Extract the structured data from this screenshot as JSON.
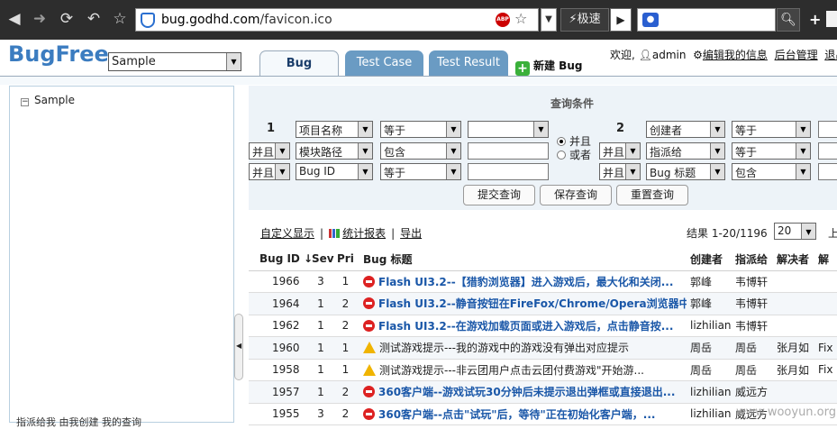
{
  "browser": {
    "url_domain": "bug.godhd.com",
    "url_path": "/favicon.ico",
    "speed_label": "极速",
    "abp_label": "ABP"
  },
  "app": {
    "logo": "BugFree",
    "project": "Sample",
    "tabs": [
      "Bug",
      "Test Case",
      "Test Result"
    ],
    "new_bug": "新建 Bug",
    "user": {
      "greeting": "欢迎,",
      "name": "admin",
      "edit_info": "编辑我的信息",
      "admin": "后台管理",
      "logout": "退出"
    }
  },
  "sidebar": {
    "root": "Sample",
    "bottom_tabs": "指派给我    由我创建    我的查询"
  },
  "query": {
    "title": "查询条件",
    "group1": "1",
    "group2": "2",
    "rows_left": [
      {
        "logic": "",
        "field": "项目名称",
        "op": "等于",
        "value": ""
      },
      {
        "logic": "并且",
        "field": "模块路径",
        "op": "包含",
        "value": ""
      },
      {
        "logic": "并且",
        "field": "Bug ID",
        "op": "等于",
        "value": ""
      }
    ],
    "rows_right": [
      {
        "logic": "",
        "field": "创建者",
        "op": "等于"
      },
      {
        "logic": "并且",
        "field": "指派给",
        "op": "等于"
      },
      {
        "logic": "并且",
        "field": "Bug 标题",
        "op": "包含"
      }
    ],
    "and_label": "并且",
    "or_label": "或者",
    "buttons": {
      "submit": "提交查询",
      "save": "保存查询",
      "reset": "重置查询"
    }
  },
  "toolbar": {
    "custom_display": "自定义显示",
    "stats": "统计报表",
    "export": "导出",
    "results": "结果 1-20/1196",
    "page_size": "20",
    "prev": "上"
  },
  "table": {
    "headers": [
      "Bug ID ↓",
      "Sev",
      "Pri",
      "Bug 标题",
      "创建者",
      "指派给",
      "解决者",
      "解"
    ],
    "rows": [
      {
        "id": "1966",
        "sev": "3",
        "pri": "1",
        "icon": "stop",
        "title": "Flash UI3.2--【猎豹浏览器】进入游戏后，最大化和关闭...",
        "creator": "郭峰",
        "assignee": "韦博轩",
        "resolver": "",
        "res": ""
      },
      {
        "id": "1964",
        "sev": "1",
        "pri": "2",
        "icon": "stop",
        "title": "Flash UI3.2--静音按钮在FireFox/Chrome/Opera浏览器中...",
        "creator": "郭峰",
        "assignee": "韦博轩",
        "resolver": "",
        "res": ""
      },
      {
        "id": "1962",
        "sev": "1",
        "pri": "2",
        "icon": "stop",
        "title": "Flash UI3.2--在游戏加载页面或进入游戏后，点击静音按...",
        "creator": "lizhiliang",
        "assignee": "韦博轩",
        "resolver": "",
        "res": ""
      },
      {
        "id": "1960",
        "sev": "1",
        "pri": "1",
        "icon": "warn",
        "title": "测试游戏提示---我的游戏中的游戏没有弹出对应提示",
        "creator": "周岳",
        "assignee": "周岳",
        "resolver": "张月如",
        "res": "Fix"
      },
      {
        "id": "1958",
        "sev": "1",
        "pri": "1",
        "icon": "warn",
        "title": "测试游戏提示---非云团用户点击云团付费游戏\"开始游...",
        "creator": "周岳",
        "assignee": "周岳",
        "resolver": "张月如",
        "res": "Fix"
      },
      {
        "id": "1957",
        "sev": "1",
        "pri": "2",
        "icon": "stop",
        "title": "360客户端--游戏试玩30分钟后未提示退出弹框或直接退出...",
        "creator": "lizhiliang",
        "assignee": "威远方",
        "resolver": "",
        "res": ""
      },
      {
        "id": "1955",
        "sev": "3",
        "pri": "2",
        "icon": "stop",
        "title": "360客户端--点击\"试玩\"后，等待\"正在初始化客户端，...",
        "creator": "lizhiliang",
        "assignee": "威远方",
        "resolver": "",
        "res": ""
      }
    ]
  },
  "watermark": "www.wooyun.org"
}
